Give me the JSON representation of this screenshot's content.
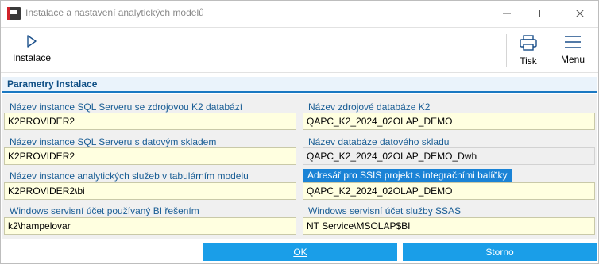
{
  "window": {
    "title": "Instalace a nastavení analytických modelů"
  },
  "toolbar": {
    "install_label": "Instalace",
    "print_label": "Tisk",
    "menu_label": "Menu"
  },
  "section": {
    "title": "Parametry Instalace"
  },
  "fields": [
    {
      "label": "Název instance SQL Serveru se zdrojovou K2 databází",
      "value": "K2PROVIDER2"
    },
    {
      "label": "Název zdrojové databáze K2",
      "value": "QAPC_K2_2024_02OLAP_DEMO"
    },
    {
      "label": "Název instance SQL Serveru s datovým skladem",
      "value": "K2PROVIDER2"
    },
    {
      "label": "Název databáze datového skladu",
      "value": "QAPC_K2_2024_02OLAP_DEMO_Dwh"
    },
    {
      "label": "Název instance analytických služeb v tabulárním modelu",
      "value": "K2PROVIDER2\\bi"
    },
    {
      "label": "Adresář pro SSIS projekt s integračními balíčky",
      "value": "QAPC_K2_2024_02OLAP_DEMO"
    },
    {
      "label": "Windows servisní účet používaný BI řešením",
      "value": "k2\\hampelovar"
    },
    {
      "label": "Windows servisní účet služby SSAS",
      "value": "NT Service\\MSOLAP$BI"
    }
  ],
  "buttons": {
    "ok_label": "OK",
    "storno_label": "Storno"
  },
  "colors": {
    "accent": "#1a9ee8",
    "section_text": "#0f4f85",
    "label_text": "#1a5e95",
    "input_bg": "#ffffe0",
    "highlight_label_bg": "#1a83d6"
  },
  "icons": {
    "app": "k2-app-icon",
    "minimize": "minimize-icon",
    "maximize": "maximize-icon",
    "close": "close-icon",
    "install": "play-icon",
    "print": "printer-icon",
    "menu": "hamburger-menu-icon"
  }
}
